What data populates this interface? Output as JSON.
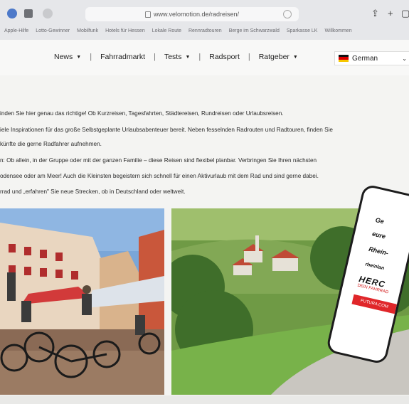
{
  "browser": {
    "url": "www.velomotion.de/radreisen/",
    "bookmarks": [
      "Apple-Hilfe",
      "Lotto-Gewinner",
      "Mobilfunk",
      "Hotels für Hessen",
      "Lokale Route",
      "Rennradtouren",
      "Berge im Schwarzwald",
      "Sparkasse LK",
      "Willkommen"
    ]
  },
  "nav": {
    "items": [
      {
        "label": "News",
        "has_caret": true
      },
      {
        "label": "Fahrradmarkt",
        "has_caret": false
      },
      {
        "label": "Tests",
        "has_caret": true
      },
      {
        "label": "Radsport",
        "has_caret": false
      },
      {
        "label": "Ratgeber",
        "has_caret": true
      }
    ],
    "language": "German"
  },
  "content": {
    "paragraphs": [
      "inden Sie hier genau das richtige! Ob Kurzreisen, Tagesfahrten, Städtereisen, Rundreisen oder Urlaubsreisen.",
      "iele Inspirationen für das große Selbstgeplante Urlaubsabenteuer bereit. Neben fesselnden Radrouten und Radtouren, finden Sie",
      "künfte die gerne Radfahrer aufnehmen.",
      "n: Ob allein, in der Gruppe oder mit der ganzen Familie – diese Reisen sind flexibel planbar. Verbringen Sie Ihren nächsten",
      "odensee oder am Meer! Auch die Kleinsten begeistern sich schnell für einen Aktivurlaub mit dem Rad und sind gerne dabei.",
      "rrad und „erfahren\" Sie neue Strecken, ob in Deutschland oder weltweit."
    ]
  },
  "phone": {
    "lines": [
      "Ge",
      "eure",
      "Rhein-",
      "rheinlan"
    ],
    "logo": "HERC",
    "subline": "DEIN FAHRRAD",
    "button": "FUTURA COM"
  },
  "colors": {
    "accent_red": "#e0262a",
    "nav_text": "#222222"
  }
}
